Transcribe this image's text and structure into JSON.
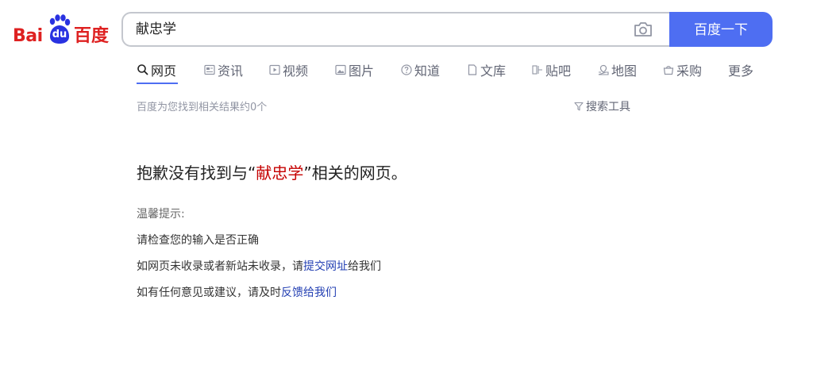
{
  "logo": {
    "bai": "Bai",
    "du": "du",
    "name": "百度"
  },
  "search": {
    "query": "献忠学",
    "camera_icon": "camera-icon",
    "button_label": "百度一下"
  },
  "tabs": [
    {
      "label": "网页",
      "icon": "search-icon",
      "active": true
    },
    {
      "label": "资讯",
      "icon": "news-icon"
    },
    {
      "label": "视频",
      "icon": "video-icon"
    },
    {
      "label": "图片",
      "icon": "image-icon"
    },
    {
      "label": "知道",
      "icon": "question-icon"
    },
    {
      "label": "文库",
      "icon": "doc-icon"
    },
    {
      "label": "贴吧",
      "icon": "tieba-icon"
    },
    {
      "label": "地图",
      "icon": "map-icon"
    },
    {
      "label": "采购",
      "icon": "basket-icon"
    },
    {
      "label": "更多"
    }
  ],
  "results": {
    "count_text": "百度为您找到相关结果约0个",
    "tools_label": "搜索工具"
  },
  "no_result": {
    "prefix": "抱歉没有找到与“",
    "keyword": "献忠学",
    "suffix": "”相关的网页。"
  },
  "tips": {
    "title": "温馨提示:",
    "line1": "请检查您的输入是否正确",
    "line2_prefix": "如网页未收录或者新站未收录，请",
    "line2_link": "提交网址",
    "line2_suffix": "给我们",
    "line3_prefix": "如有任何意见或建议，请及时",
    "line3_link": "反馈给我们"
  },
  "colors": {
    "brand_red": "#de2121",
    "brand_blue": "#4e6ef2",
    "keyword_red": "#c50000",
    "link_blue": "#2440b3"
  }
}
